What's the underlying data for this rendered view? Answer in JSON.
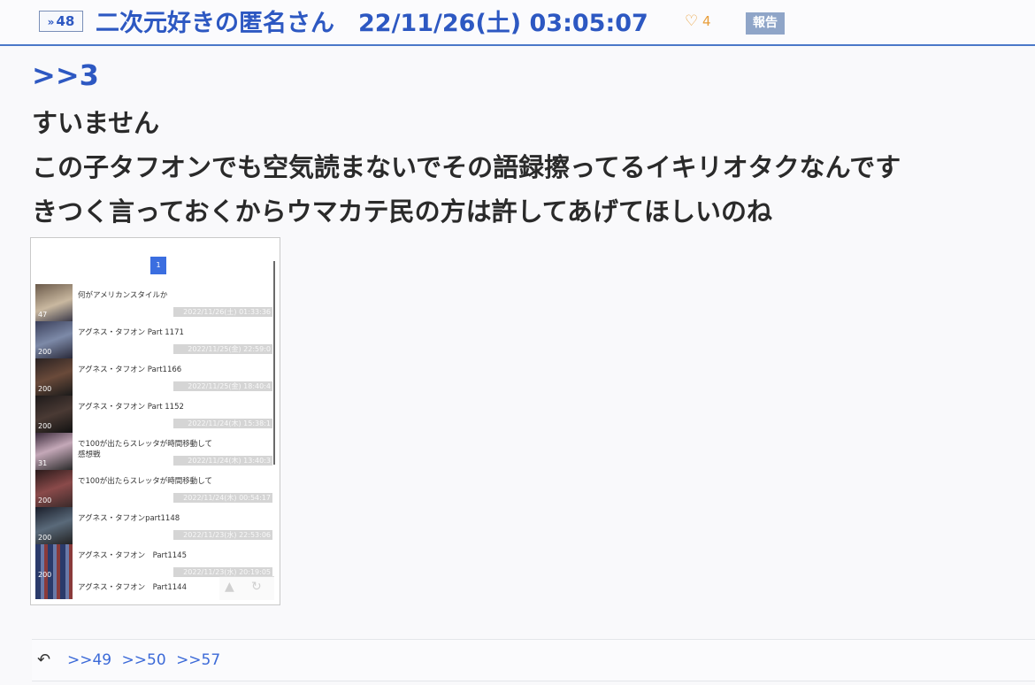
{
  "header": {
    "res_number_arrow": "»",
    "res_number": "48",
    "author": "二次元好きの匿名さん",
    "datetime": "22/11/26(土) 03:05:07",
    "like_count": "4",
    "report_label": "報告"
  },
  "post": {
    "anchor": ">>3",
    "lines": [
      "すいません",
      "この子タフオンでも空気読まないでその語録擦ってるイキリオタクなんです",
      "きつく言っておくからウマカテ民の方は許してあげてほしいのね"
    ]
  },
  "thumbnail": {
    "page_number": "1",
    "threads": [
      {
        "title": "何がアメリカンスタイルか",
        "count": "47",
        "date": "2022/11/26(土) 01:33:36"
      },
      {
        "title": "アグネス・タフオン Part 1171",
        "count": "200",
        "date": "2022/11/25(金) 22:59:0"
      },
      {
        "title": "アグネス・タフオン Part1166",
        "count": "200",
        "date": "2022/11/25(金) 18:40:4"
      },
      {
        "title": "アグネス・タフオン Part 1152",
        "count": "200",
        "date": "2022/11/24(木) 15:38:1"
      },
      {
        "title": "で100が出たらスレッタが時間移動して",
        "title2": "感想戦",
        "count": "31",
        "date": "2022/11/24(木) 13:40:3"
      },
      {
        "title": "で100が出たらスレッタが時間移動して",
        "count": "200",
        "date": "2022/11/24(木) 00:54:17"
      },
      {
        "title": "アグネス・タフオンpart1148",
        "count": "200",
        "date": "2022/11/23(水) 22:53:06"
      },
      {
        "title": "アグネス・タフオン　Part1145",
        "count": "200",
        "date": "2022/11/23(水) 20:19:05"
      },
      {
        "title": "アグネス・タフオン　Part1144",
        "count": "",
        "date": ""
      }
    ]
  },
  "replies": {
    "links": [
      ">>49",
      ">>50",
      ">>57"
    ]
  },
  "colors": {
    "accent": "#2d58c2",
    "like": "#e89e3a",
    "report_bg": "#8fa5c8"
  }
}
